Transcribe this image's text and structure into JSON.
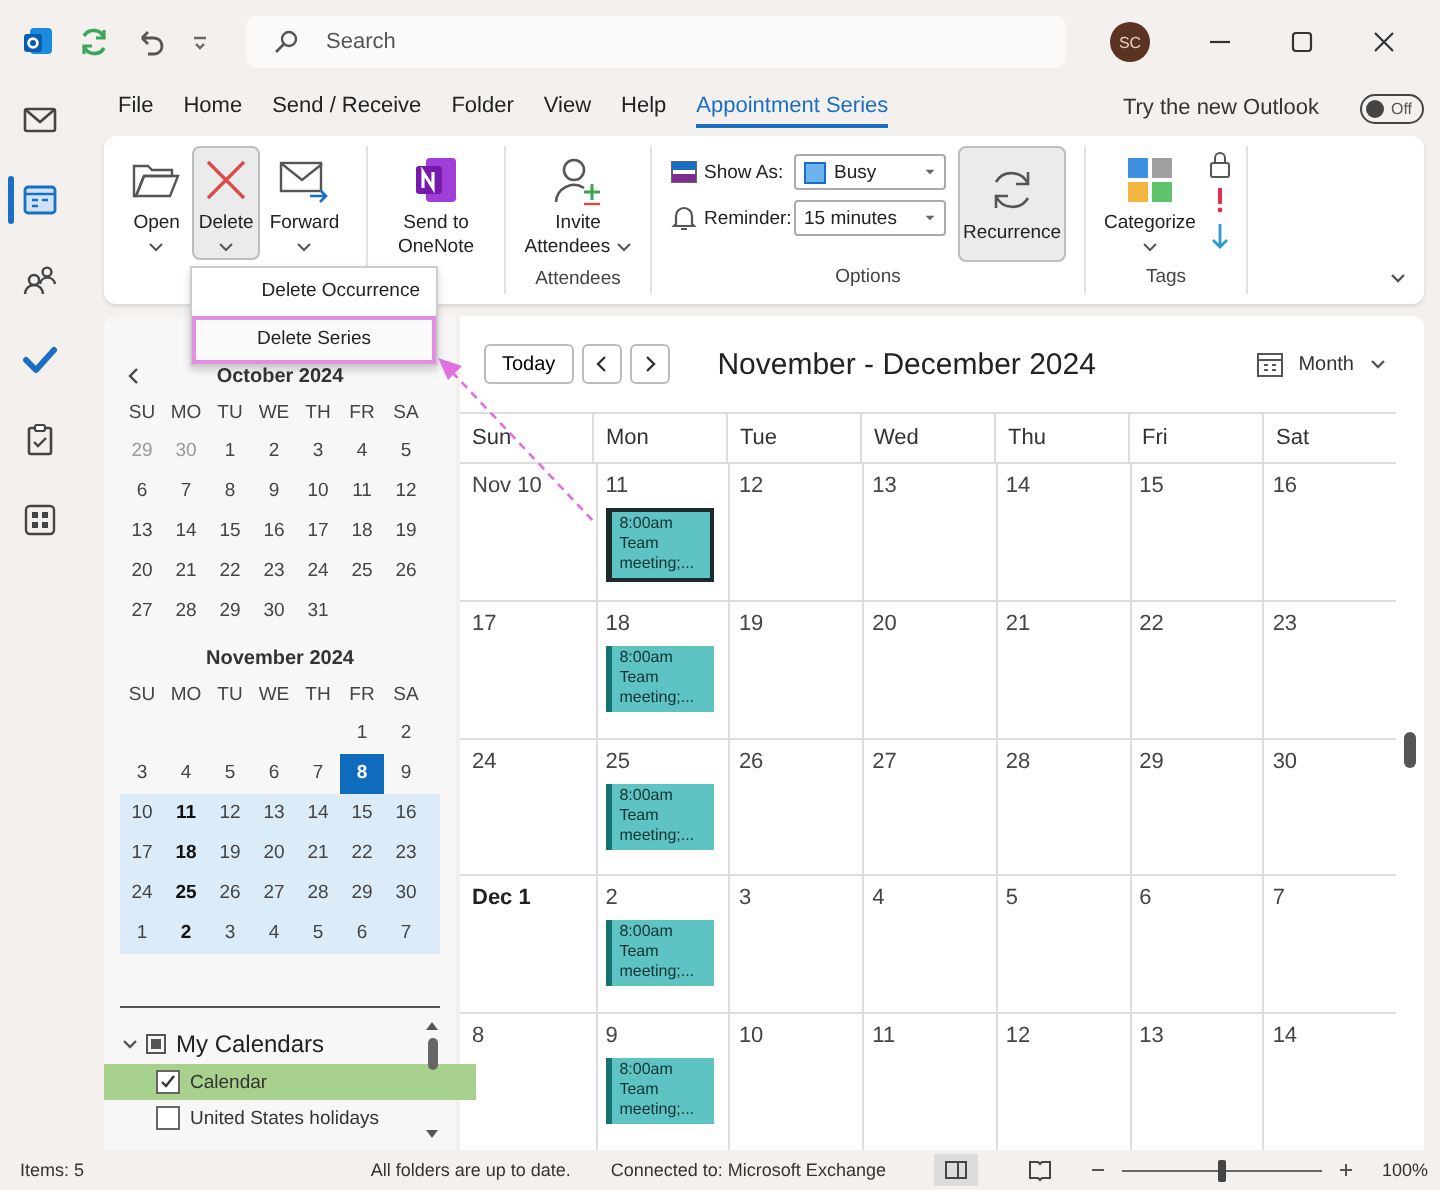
{
  "title_bar": {
    "search_placeholder": "Search",
    "avatar": "SC"
  },
  "nav_rail": [
    {
      "kind": "mail",
      "selected": false
    },
    {
      "kind": "calendar",
      "selected": true
    },
    {
      "kind": "people",
      "selected": false
    },
    {
      "kind": "todo",
      "selected": false
    },
    {
      "kind": "notes",
      "selected": false
    },
    {
      "kind": "apps",
      "selected": false
    }
  ],
  "menu_tabs": [
    {
      "label": "File",
      "selected": false
    },
    {
      "label": "Home",
      "selected": false
    },
    {
      "label": "Send / Receive",
      "selected": false
    },
    {
      "label": "Folder",
      "selected": false
    },
    {
      "label": "View",
      "selected": false
    },
    {
      "label": "Help",
      "selected": false
    },
    {
      "label": "Appointment Series",
      "selected": true
    }
  ],
  "try_new": {
    "label": "Try the new Outlook",
    "toggle": "Off",
    "on": false
  },
  "ribbon": {
    "actions": [
      {
        "label": "Open",
        "kind": "open",
        "pressed": false
      },
      {
        "label": "Delete",
        "kind": "delete",
        "pressed": true
      },
      {
        "label": "Forward",
        "kind": "forward",
        "pressed": false
      }
    ],
    "onenote": {
      "label": "Send to OneNote",
      "kind": "onenote"
    },
    "attendees": {
      "label": "Attendees",
      "action": "Invite Attendees"
    },
    "options": {
      "label": "Options",
      "show_as": {
        "label": "Show As:",
        "value": "Busy"
      },
      "reminder": {
        "label": "Reminder:",
        "value": "15 minutes"
      },
      "recurrence": {
        "label": "Recurrence",
        "pressed": true
      }
    },
    "tags": {
      "label": "Tags",
      "categorize": "Categorize"
    }
  },
  "dropdown": {
    "items": [
      {
        "label": "Delete Occurrence",
        "selected": false
      },
      {
        "label": "Delete Series",
        "selected": true
      }
    ]
  },
  "mini_calendars": [
    {
      "title": "October 2024",
      "weekdays": [
        "SU",
        "MO",
        "TU",
        "WE",
        "TH",
        "FR",
        "SA"
      ],
      "weeks": [
        {
          "in_view": false,
          "days": [
            {
              "d": "29",
              "muted": true,
              "bold": false,
              "today": false
            },
            {
              "d": "30",
              "muted": true,
              "bold": false,
              "today": false
            },
            {
              "d": "1",
              "muted": false,
              "bold": false,
              "today": false
            },
            {
              "d": "2",
              "muted": false,
              "bold": false,
              "today": false
            },
            {
              "d": "3",
              "muted": false,
              "bold": false,
              "today": false
            },
            {
              "d": "4",
              "muted": false,
              "bold": false,
              "today": false
            },
            {
              "d": "5",
              "muted": false,
              "bold": false,
              "today": false
            }
          ]
        },
        {
          "in_view": false,
          "days": [
            {
              "d": "6",
              "muted": false,
              "bold": false,
              "today": false
            },
            {
              "d": "7",
              "muted": false,
              "bold": false,
              "today": false
            },
            {
              "d": "8",
              "muted": false,
              "bold": false,
              "today": false
            },
            {
              "d": "9",
              "muted": false,
              "bold": false,
              "today": false
            },
            {
              "d": "10",
              "muted": false,
              "bold": false,
              "today": false
            },
            {
              "d": "11",
              "muted": false,
              "bold": false,
              "today": false
            },
            {
              "d": "12",
              "muted": false,
              "bold": false,
              "today": false
            }
          ]
        },
        {
          "in_view": false,
          "days": [
            {
              "d": "13",
              "muted": false,
              "bold": false,
              "today": false
            },
            {
              "d": "14",
              "muted": false,
              "bold": false,
              "today": false
            },
            {
              "d": "15",
              "muted": false,
              "bold": false,
              "today": false
            },
            {
              "d": "16",
              "muted": false,
              "bold": false,
              "today": false
            },
            {
              "d": "17",
              "muted": false,
              "bold": false,
              "today": false
            },
            {
              "d": "18",
              "muted": false,
              "bold": false,
              "today": false
            },
            {
              "d": "19",
              "muted": false,
              "bold": false,
              "today": false
            }
          ]
        },
        {
          "in_view": false,
          "days": [
            {
              "d": "20",
              "muted": false,
              "bold": false,
              "today": false
            },
            {
              "d": "21",
              "muted": false,
              "bold": false,
              "today": false
            },
            {
              "d": "22",
              "muted": false,
              "bold": false,
              "today": false
            },
            {
              "d": "23",
              "muted": false,
              "bold": false,
              "today": false
            },
            {
              "d": "24",
              "muted": false,
              "bold": false,
              "today": false
            },
            {
              "d": "25",
              "muted": false,
              "bold": false,
              "today": false
            },
            {
              "d": "26",
              "muted": false,
              "bold": false,
              "today": false
            }
          ]
        },
        {
          "in_view": false,
          "days": [
            {
              "d": "27",
              "muted": false,
              "bold": false,
              "today": false
            },
            {
              "d": "28",
              "muted": false,
              "bold": false,
              "today": false
            },
            {
              "d": "29",
              "muted": false,
              "bold": false,
              "today": false
            },
            {
              "d": "30",
              "muted": false,
              "bold": false,
              "today": false
            },
            {
              "d": "31",
              "muted": false,
              "bold": false,
              "today": false
            }
          ]
        }
      ]
    },
    {
      "title": "November 2024",
      "weekdays": [
        "SU",
        "MO",
        "TU",
        "WE",
        "TH",
        "FR",
        "SA"
      ],
      "weeks": [
        {
          "in_view": false,
          "days": [
            {
              "d": "1",
              "muted": false,
              "bold": false,
              "today": false
            },
            {
              "d": "2",
              "muted": false,
              "bold": false,
              "today": false
            }
          ]
        },
        {
          "in_view": false,
          "days": [
            {
              "d": "3",
              "muted": false,
              "bold": false,
              "today": false
            },
            {
              "d": "4",
              "muted": false,
              "bold": false,
              "today": false
            },
            {
              "d": "5",
              "muted": false,
              "bold": false,
              "today": false
            },
            {
              "d": "6",
              "muted": false,
              "bold": false,
              "today": false
            },
            {
              "d": "7",
              "muted": false,
              "bold": false,
              "today": false
            },
            {
              "d": "8",
              "muted": false,
              "bold": false,
              "today": true
            },
            {
              "d": "9",
              "muted": false,
              "bold": false,
              "today": false
            }
          ]
        },
        {
          "in_view": true,
          "days": [
            {
              "d": "10",
              "muted": false,
              "bold": false,
              "today": false
            },
            {
              "d": "11",
              "muted": false,
              "bold": true,
              "today": false
            },
            {
              "d": "12",
              "muted": false,
              "bold": false,
              "today": false
            },
            {
              "d": "13",
              "muted": false,
              "bold": false,
              "today": false
            },
            {
              "d": "14",
              "muted": false,
              "bold": false,
              "today": false
            },
            {
              "d": "15",
              "muted": false,
              "bold": false,
              "today": false
            },
            {
              "d": "16",
              "muted": false,
              "bold": false,
              "today": false
            }
          ]
        },
        {
          "in_view": true,
          "days": [
            {
              "d": "17",
              "muted": false,
              "bold": false,
              "today": false
            },
            {
              "d": "18",
              "muted": false,
              "bold": true,
              "today": false
            },
            {
              "d": "19",
              "muted": false,
              "bold": false,
              "today": false
            },
            {
              "d": "20",
              "muted": false,
              "bold": false,
              "today": false
            },
            {
              "d": "21",
              "muted": false,
              "bold": false,
              "today": false
            },
            {
              "d": "22",
              "muted": false,
              "bold": false,
              "today": false
            },
            {
              "d": "23",
              "muted": false,
              "bold": false,
              "today": false
            }
          ]
        },
        {
          "in_view": true,
          "days": [
            {
              "d": "24",
              "muted": false,
              "bold": false,
              "today": false
            },
            {
              "d": "25",
              "muted": false,
              "bold": true,
              "today": false
            },
            {
              "d": "26",
              "muted": false,
              "bold": false,
              "today": false
            },
            {
              "d": "27",
              "muted": false,
              "bold": false,
              "today": false
            },
            {
              "d": "28",
              "muted": false,
              "bold": false,
              "today": false
            },
            {
              "d": "29",
              "muted": false,
              "bold": false,
              "today": false
            },
            {
              "d": "30",
              "muted": false,
              "bold": false,
              "today": false
            }
          ]
        },
        {
          "in_view": true,
          "days": [
            {
              "d": "1",
              "muted": false,
              "bold": false,
              "today": false
            },
            {
              "d": "2",
              "muted": false,
              "bold": true,
              "today": false
            },
            {
              "d": "3",
              "muted": false,
              "bold": false,
              "today": false
            },
            {
              "d": "4",
              "muted": false,
              "bold": false,
              "today": false
            },
            {
              "d": "5",
              "muted": false,
              "bold": false,
              "today": false
            },
            {
              "d": "6",
              "muted": false,
              "bold": false,
              "today": false
            },
            {
              "d": "7",
              "muted": false,
              "bold": false,
              "today": false
            }
          ]
        }
      ]
    }
  ],
  "calendars": {
    "title": "My Calendars",
    "expanded": true,
    "items": [
      {
        "label": "Calendar",
        "checked": true,
        "selected": true
      },
      {
        "label": "United States holidays",
        "checked": false,
        "selected": false
      }
    ]
  },
  "month_view": {
    "today": "Today",
    "title": "November - December 2024",
    "view": "Month",
    "weekdays": [
      "Sun",
      "Mon",
      "Tue",
      "Wed",
      "Thu",
      "Fri",
      "Sat"
    ],
    "weeks": [
      [
        {
          "label": "Nov 10",
          "bold": false
        },
        {
          "label": "11",
          "bold": false,
          "events": [
            {
              "text": "8:00am Team meeting;...",
              "selected": true
            }
          ]
        },
        {
          "label": "12",
          "bold": false
        },
        {
          "label": "13",
          "bold": false
        },
        {
          "label": "14",
          "bold": false
        },
        {
          "label": "15",
          "bold": false
        },
        {
          "label": "16",
          "bold": false
        }
      ],
      [
        {
          "label": "17",
          "bold": false
        },
        {
          "label": "18",
          "bold": false,
          "events": [
            {
              "text": "8:00am Team meeting;...",
              "selected": false
            }
          ]
        },
        {
          "label": "19",
          "bold": false
        },
        {
          "label": "20",
          "bold": false
        },
        {
          "label": "21",
          "bold": false
        },
        {
          "label": "22",
          "bold": false
        },
        {
          "label": "23",
          "bold": false
        }
      ],
      [
        {
          "label": "24",
          "bold": false
        },
        {
          "label": "25",
          "bold": false,
          "events": [
            {
              "text": "8:00am Team meeting;...",
              "selected": false
            }
          ]
        },
        {
          "label": "26",
          "bold": false
        },
        {
          "label": "27",
          "bold": false
        },
        {
          "label": "28",
          "bold": false
        },
        {
          "label": "29",
          "bold": false
        },
        {
          "label": "30",
          "bold": false
        }
      ],
      [
        {
          "label": "Dec 1",
          "bold": true
        },
        {
          "label": "2",
          "bold": false,
          "events": [
            {
              "text": "8:00am Team meeting;...",
              "selected": false
            }
          ]
        },
        {
          "label": "3",
          "bold": false
        },
        {
          "label": "4",
          "bold": false
        },
        {
          "label": "5",
          "bold": false
        },
        {
          "label": "6",
          "bold": false
        },
        {
          "label": "7",
          "bold": false
        }
      ],
      [
        {
          "label": "8",
          "bold": false
        },
        {
          "label": "9",
          "bold": false,
          "events": [
            {
              "text": "8:00am Team meeting;...",
              "selected": false
            }
          ]
        },
        {
          "label": "10",
          "bold": false
        },
        {
          "label": "11",
          "bold": false
        },
        {
          "label": "12",
          "bold": false
        },
        {
          "label": "13",
          "bold": false
        },
        {
          "label": "14",
          "bold": false
        }
      ]
    ]
  },
  "status_bar": {
    "items": "Items: 5",
    "sync": "All folders are up to date.",
    "connection": "Connected to: Microsoft Exchange",
    "views": [
      {
        "kind": "normal",
        "selected": true
      },
      {
        "kind": "reading",
        "selected": false
      }
    ],
    "zoom": {
      "level": 0.5,
      "label": "100%"
    }
  }
}
